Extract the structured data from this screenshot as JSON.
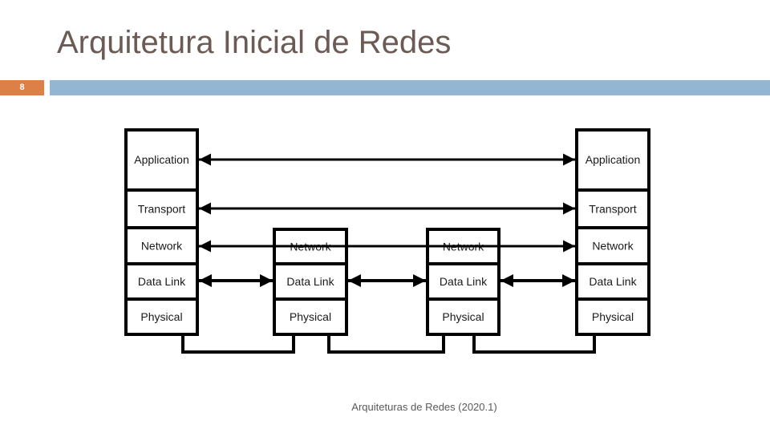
{
  "slide": {
    "title": "Arquitetura Inicial de Redes",
    "number": "8",
    "footer": "Arquiteturas de Redes (2020.1)",
    "colors": {
      "title": "#6b5b54",
      "slide_number_bg": "#dd8047",
      "accent_bar": "#94b6d2",
      "diagram_stroke": "#000000"
    }
  },
  "diagram": {
    "stacks": [
      {
        "id": "host-a",
        "layers": [
          "Application",
          "Transport",
          "Network",
          "Data Link",
          "Physical"
        ]
      },
      {
        "id": "router-1",
        "layers": [
          "Network",
          "Data Link",
          "Physical"
        ]
      },
      {
        "id": "router-2",
        "layers": [
          "Network",
          "Data Link",
          "Physical"
        ]
      },
      {
        "id": "host-b",
        "layers": [
          "Application",
          "Transport",
          "Network",
          "Data Link",
          "Physical"
        ]
      }
    ],
    "peer_links": [
      {
        "layer": "Application",
        "from": "host-a",
        "to": "host-b",
        "style": "end-to-end"
      },
      {
        "layer": "Transport",
        "from": "host-a",
        "to": "host-b",
        "style": "end-to-end"
      },
      {
        "layer": "Network",
        "from": "host-a",
        "to": "host-b",
        "style": "through-routers"
      },
      {
        "layer": "Data Link",
        "from": "host-a",
        "to": "router-1",
        "style": "hop"
      },
      {
        "layer": "Data Link",
        "from": "router-1",
        "to": "router-2",
        "style": "hop"
      },
      {
        "layer": "Data Link",
        "from": "router-2",
        "to": "host-b",
        "style": "hop"
      }
    ],
    "physical_links": [
      {
        "from": "host-a",
        "to": "router-1"
      },
      {
        "from": "router-1",
        "to": "router-2"
      },
      {
        "from": "router-2",
        "to": "host-b"
      }
    ]
  }
}
